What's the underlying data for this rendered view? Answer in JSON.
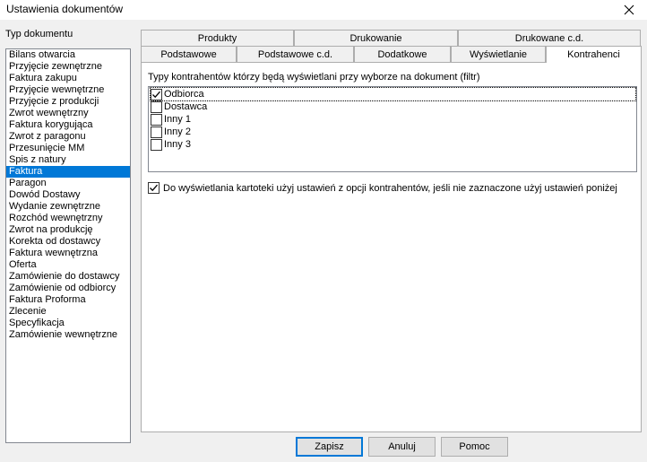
{
  "window": {
    "title": "Ustawienia dokumentów",
    "close_icon": "close-icon"
  },
  "doc_type": {
    "label": "Typ dokumentu",
    "selected_index": 10,
    "items": [
      "Bilans otwarcia",
      "Przyjęcie zewnętrzne",
      "Faktura zakupu",
      "Przyjęcie wewnętrzne",
      "Przyjęcie z produkcji",
      "Zwrot wewnętrzny",
      "Faktura korygująca",
      "Zwrot z paragonu",
      "Przesunięcie MM",
      "Spis z natury",
      "Faktura",
      "Paragon",
      "Dowód Dostawy",
      "Wydanie zewnętrzne",
      "Rozchód wewnętrzny",
      "Zwrot na produkcję",
      "Korekta od dostawcy",
      "Faktura wewnętrzna",
      "Oferta",
      "Zamówienie do dostawcy",
      "Zamówienie od odbiorcy",
      "Faktura Proforma",
      "Zlecenie",
      "Specyfikacja",
      "Zamówienie wewnętrzne"
    ]
  },
  "tabs": {
    "row1": [
      "Produkty",
      "Drukowanie",
      "Drukowane c.d."
    ],
    "row2": [
      "Podstawowe",
      "Podstawowe c.d.",
      "Dodatkowe",
      "Wyświetlanie",
      "Kontrahenci"
    ],
    "active": "Kontrahenci"
  },
  "contractors": {
    "filter_label": "Typy kontrahentów którzy będą wyświetlani przy wyborze na dokument (filtr)",
    "items": [
      {
        "label": "Odbiorca",
        "checked": true
      },
      {
        "label": "Dostawca",
        "checked": false
      },
      {
        "label": "Inny 1",
        "checked": false
      },
      {
        "label": "Inny 2",
        "checked": false
      },
      {
        "label": "Inny 3",
        "checked": false
      }
    ],
    "option_label": "Do wyświetlania kartoteki użyj ustawień z opcji kontrahentów, jeśli nie zaznaczone użyj ustawień poniżej",
    "option_checked": true
  },
  "buttons": {
    "save": "Zapisz",
    "cancel": "Anuluj",
    "help": "Pomoc"
  },
  "colors": {
    "selection": "#0078d7",
    "background": "#f0f0f0"
  }
}
